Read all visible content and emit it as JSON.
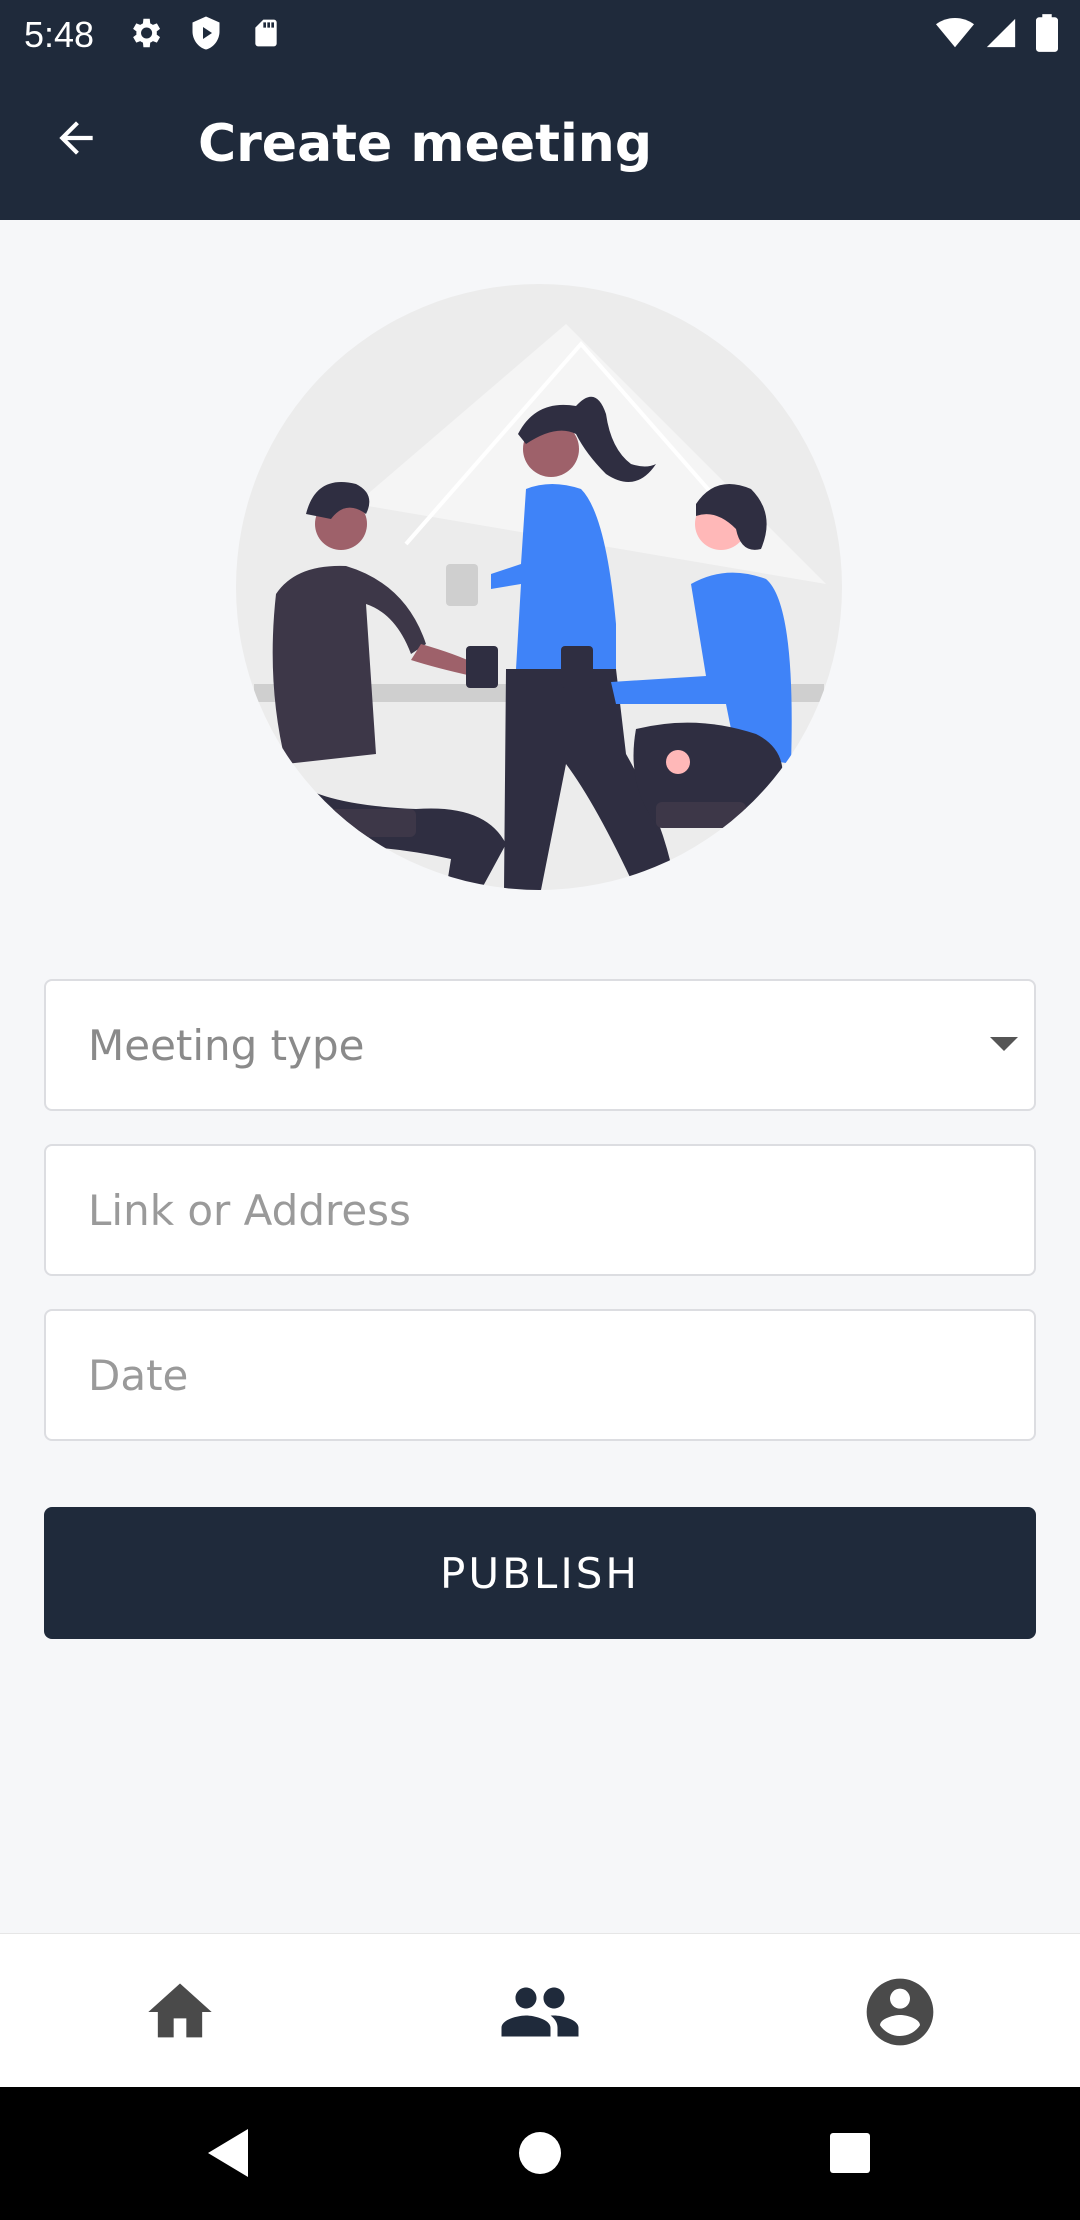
{
  "status_bar": {
    "time": "5:48",
    "icons": [
      "gear-icon",
      "shield-icon",
      "sd-card-icon",
      "wifi-icon",
      "signal-icon",
      "battery-icon"
    ]
  },
  "app_bar": {
    "title": "Create meeting",
    "back_icon": "arrow-back-icon"
  },
  "illustration": {
    "subject": "meeting-people-illustration"
  },
  "form": {
    "meeting_type": {
      "placeholder": "Meeting type"
    },
    "link_or_address": {
      "placeholder": "Link or Address"
    },
    "date": {
      "placeholder": "Date"
    },
    "publish_label": "PUBLISH"
  },
  "bottom_nav": {
    "items": [
      "home-icon",
      "group-icon",
      "account-icon"
    ]
  },
  "system_nav": {
    "items": [
      "back-triangle-icon",
      "home-circle-icon",
      "recents-square-icon"
    ]
  },
  "colors": {
    "primary": "#1f2a3b",
    "background": "#f6f7f9",
    "accent_blue": "#3f83f8"
  }
}
